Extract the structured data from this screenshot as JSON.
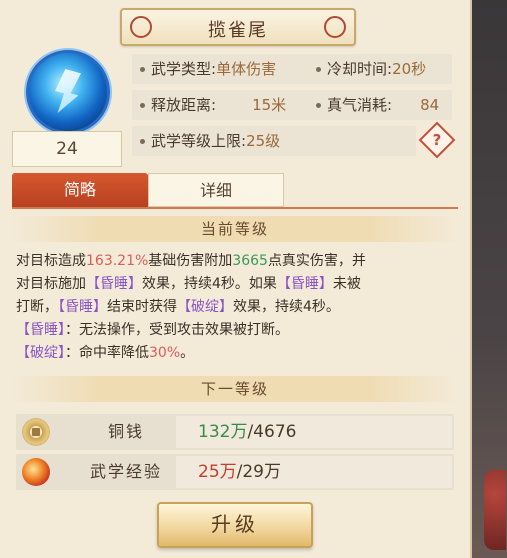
{
  "title": "揽雀尾",
  "skill": {
    "level": "24",
    "icon": "skill-icon"
  },
  "attributes": {
    "type_label": "武学类型:",
    "type_value": "单体伤害",
    "cooldown_label": "冷却时间:",
    "cooldown_value": "20秒",
    "range_label": "释放距离:",
    "range_value": "15米",
    "qi_label": "真气消耗:",
    "qi_value": "84",
    "max_level_label": "武学等级上限:",
    "max_level_value": "25级",
    "help": "?"
  },
  "tabs": [
    "简略",
    "详细"
  ],
  "current_level": {
    "header": "当前等级",
    "line1_a": "对目标造成",
    "line1_b": "163.21%",
    "line1_c": "基础伤害附加",
    "line1_d": "3665",
    "line1_e": "点真实伤害，并",
    "line2_a": "对目标施加",
    "line2_b": "【昏睡】",
    "line2_c": "效果，持续4秒。如果",
    "line2_d": "【昏睡】",
    "line2_e": "未被",
    "line3_a": "打断，",
    "line3_b": "【昏睡】",
    "line3_c": "结束时获得",
    "line3_d": "【破绽】",
    "line3_e": "效果，持续4秒。",
    "line4_a": "【昏睡】",
    "line4_b": "：无法操作，受到攻击效果被打断。",
    "line5_a": "【破绽】",
    "line5_b": "：命中率降低",
    "line5_c": "30%",
    "line5_d": "。"
  },
  "next_level": {
    "header": "下一等级"
  },
  "costs": {
    "copper_label": "铜钱",
    "copper_have": "132万",
    "copper_need": "/4676",
    "exp_label": "武学经验",
    "exp_have": "25万",
    "exp_need": "/29万"
  },
  "upgrade_button": "升级"
}
